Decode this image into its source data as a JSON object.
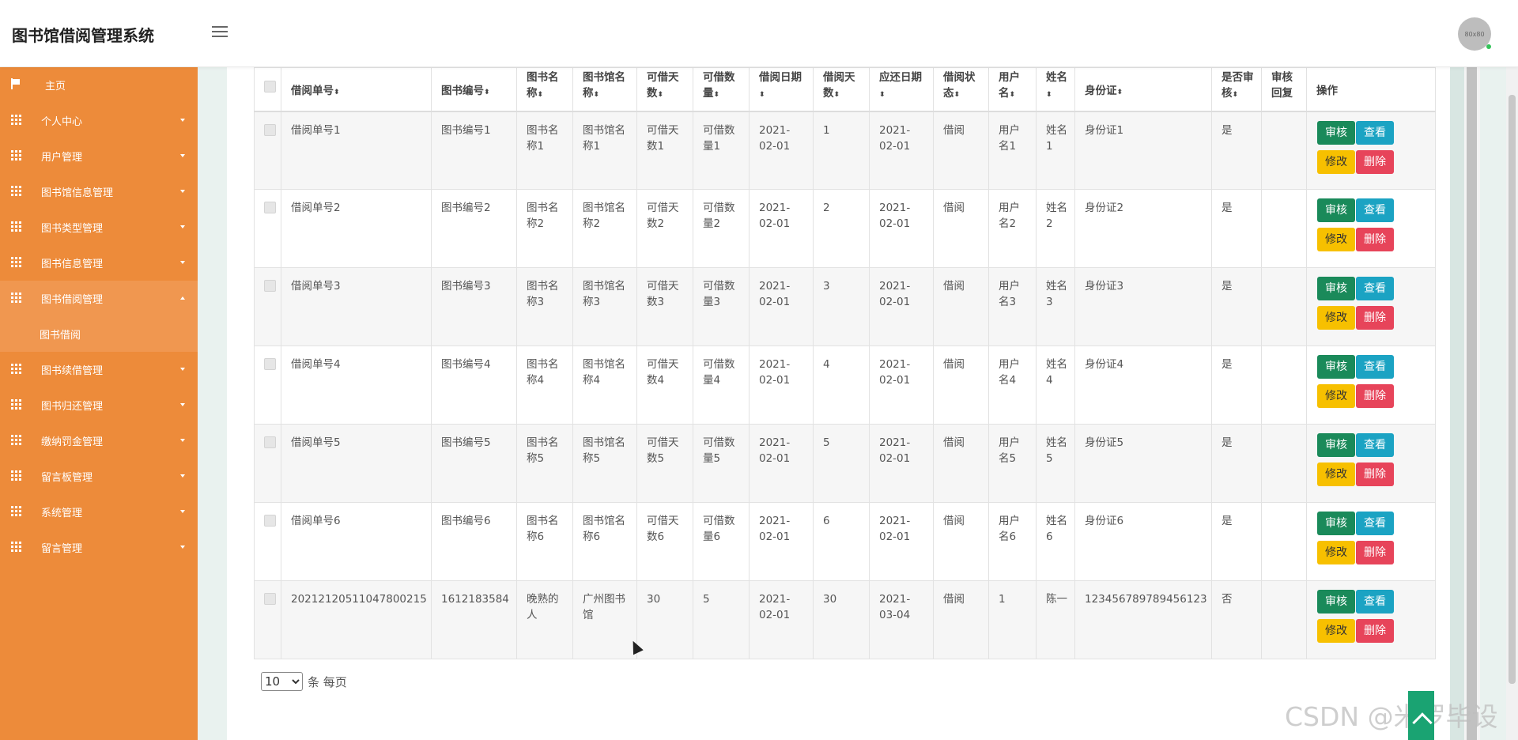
{
  "header": {
    "title": "图书馆借阅管理系统",
    "avatar_text": "80x80"
  },
  "sidebar": {
    "home": "主页",
    "items": [
      {
        "label": "个人中心",
        "expanded": false
      },
      {
        "label": "用户管理",
        "expanded": false
      },
      {
        "label": "图书馆信息管理",
        "expanded": false
      },
      {
        "label": "图书类型管理",
        "expanded": false
      },
      {
        "label": "图书信息管理",
        "expanded": false
      },
      {
        "label": "图书借阅管理",
        "expanded": true
      },
      {
        "label": "图书续借管理",
        "expanded": false
      },
      {
        "label": "图书归还管理",
        "expanded": false
      },
      {
        "label": "缴纳罚金管理",
        "expanded": false
      },
      {
        "label": "留言板管理",
        "expanded": false
      },
      {
        "label": "系统管理",
        "expanded": false
      },
      {
        "label": "留言管理",
        "expanded": false
      }
    ],
    "sub_item": "图书借阅"
  },
  "table": {
    "headers": [
      {
        "text": "借阅单号",
        "sort": true
      },
      {
        "text": "图书编号",
        "sort": true
      },
      {
        "text": "图书名称",
        "sort": true
      },
      {
        "text": "图书馆名称",
        "sort": true
      },
      {
        "text": "可借天数",
        "sort": true
      },
      {
        "text": "可借数量",
        "sort": true
      },
      {
        "text": "借阅日期",
        "sort": true
      },
      {
        "text": "借阅天数",
        "sort": true
      },
      {
        "text": "应还日期",
        "sort": true
      },
      {
        "text": "借阅状态",
        "sort": true
      },
      {
        "text": "用户名",
        "sort": true
      },
      {
        "text": "姓名",
        "sort": true
      },
      {
        "text": "身份证",
        "sort": true
      },
      {
        "text": "是否审核",
        "sort": true
      },
      {
        "text": "审核回复",
        "sort": false
      },
      {
        "text": "操作",
        "sort": false
      }
    ],
    "sort_glyph": "⬍",
    "rows": [
      [
        "借阅单号1",
        "图书编号1",
        "图书名称1",
        "图书馆名称1",
        "可借天数1",
        "可借数量1",
        "2021-02-01",
        "1",
        "2021-02-01",
        "借阅",
        "用户名1",
        "姓名1",
        "身份证1",
        "是",
        ""
      ],
      [
        "借阅单号2",
        "图书编号2",
        "图书名称2",
        "图书馆名称2",
        "可借天数2",
        "可借数量2",
        "2021-02-01",
        "2",
        "2021-02-01",
        "借阅",
        "用户名2",
        "姓名2",
        "身份证2",
        "是",
        ""
      ],
      [
        "借阅单号3",
        "图书编号3",
        "图书名称3",
        "图书馆名称3",
        "可借天数3",
        "可借数量3",
        "2021-02-01",
        "3",
        "2021-02-01",
        "借阅",
        "用户名3",
        "姓名3",
        "身份证3",
        "是",
        ""
      ],
      [
        "借阅单号4",
        "图书编号4",
        "图书名称4",
        "图书馆名称4",
        "可借天数4",
        "可借数量4",
        "2021-02-01",
        "4",
        "2021-02-01",
        "借阅",
        "用户名4",
        "姓名4",
        "身份证4",
        "是",
        ""
      ],
      [
        "借阅单号5",
        "图书编号5",
        "图书名称5",
        "图书馆名称5",
        "可借天数5",
        "可借数量5",
        "2021-02-01",
        "5",
        "2021-02-01",
        "借阅",
        "用户名5",
        "姓名5",
        "身份证5",
        "是",
        ""
      ],
      [
        "借阅单号6",
        "图书编号6",
        "图书名称6",
        "图书馆名称6",
        "可借天数6",
        "可借数量6",
        "2021-02-01",
        "6",
        "2021-02-01",
        "借阅",
        "用户名6",
        "姓名6",
        "身份证6",
        "是",
        ""
      ],
      [
        "20212120511047800215",
        "1612183584",
        "晚熟的人",
        "广州图书馆",
        "30",
        "5",
        "2021-02-01",
        "30",
        "2021-03-04",
        "借阅",
        "1",
        "陈一",
        "123456789789456123",
        "否",
        ""
      ]
    ],
    "actions": {
      "audit": "审核",
      "view": "查看",
      "edit": "修改",
      "delete": "删除"
    }
  },
  "pager": {
    "page_size": "10",
    "options": [
      "10"
    ],
    "suffix": "条 每页"
  },
  "watermark": "CSDN @米罗毕设",
  "colors": {
    "sidebar": "#ed8b3a",
    "audit": "#1a8a5a",
    "view": "#1ba3c3",
    "edit": "#f7c000",
    "delete": "#e7445a"
  }
}
